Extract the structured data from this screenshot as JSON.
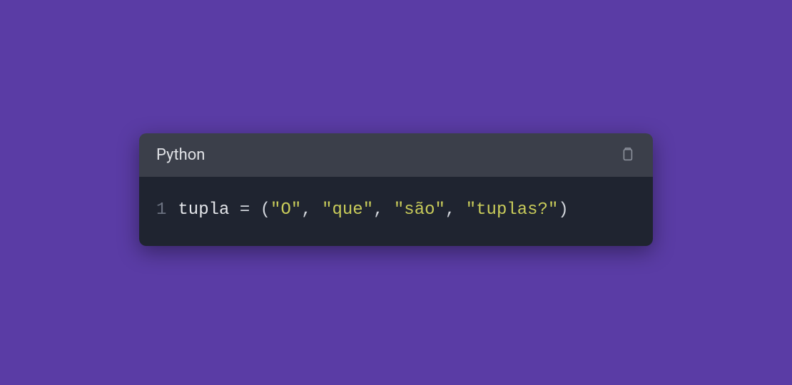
{
  "codeBlock": {
    "language": "Python",
    "lines": [
      {
        "number": "1",
        "tokens": {
          "var": "tupla",
          "sp1": " ",
          "op": "=",
          "sp2": " ",
          "lparen": "(",
          "str1": "\"O\"",
          "c1": ", ",
          "str2": "\"que\"",
          "c2": ", ",
          "str3": "\"são\"",
          "c3": ", ",
          "str4": "\"tuplas?\"",
          "rparen": ")"
        }
      }
    ]
  }
}
